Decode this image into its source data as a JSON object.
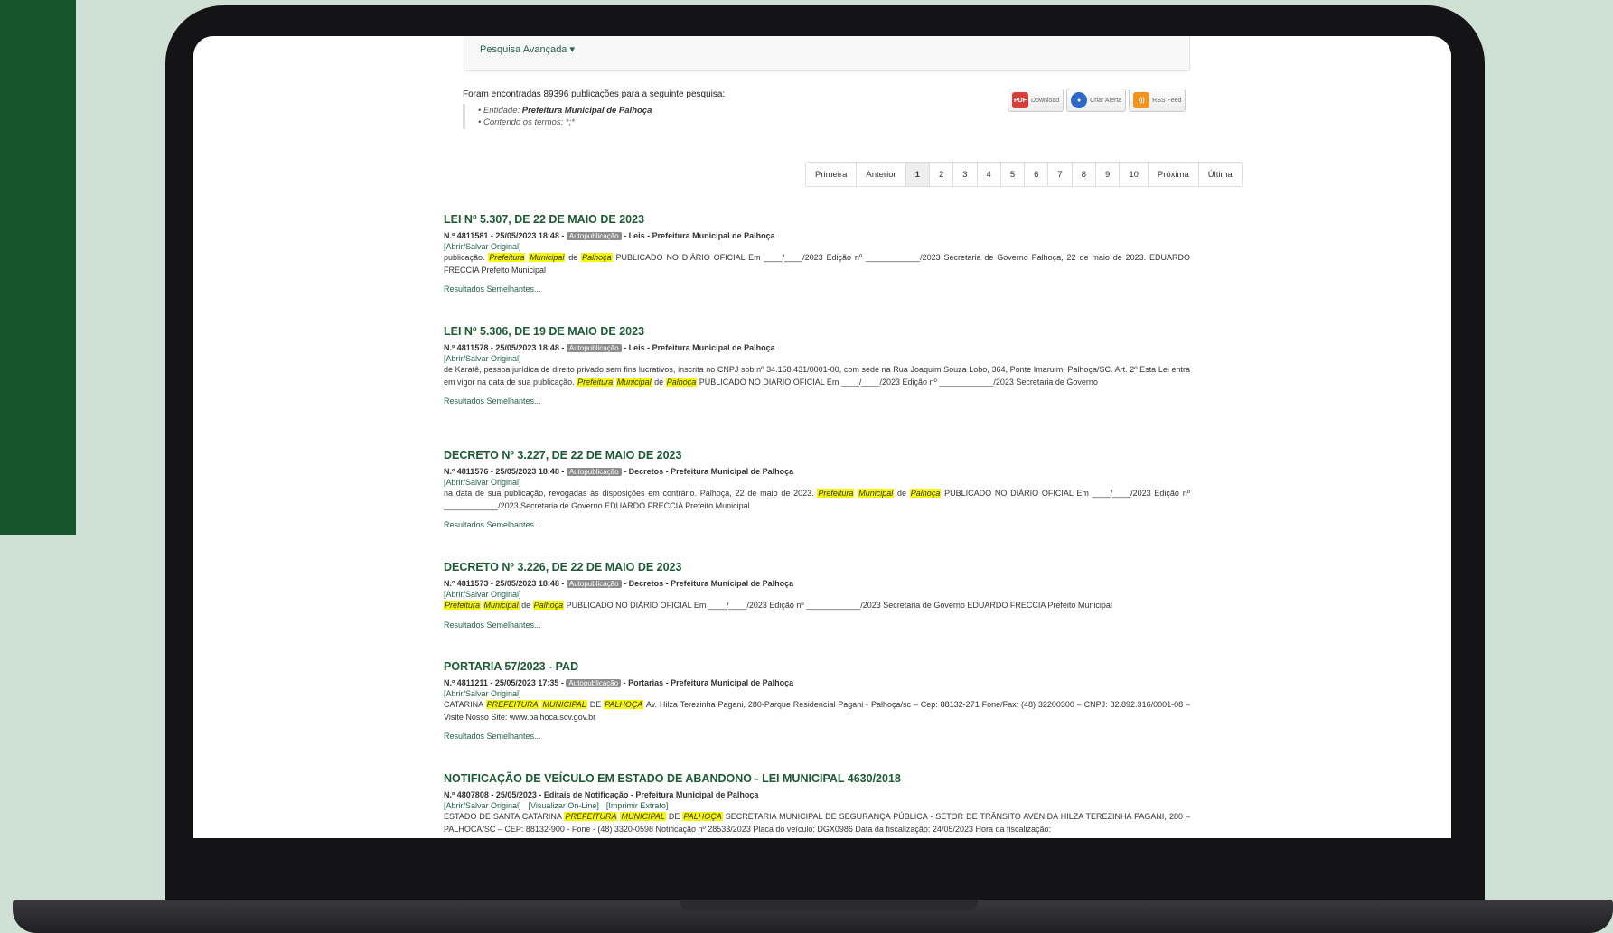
{
  "search": {
    "advanced_label": "Pesquisa Avançada ▾",
    "summary": "Foram encontradas 89396 publicações para a seguinte pesquisa:",
    "criteria": [
      {
        "label": "Entidade:",
        "value": "Prefeitura Municipal de Palhoça"
      },
      {
        "label": "Contendo os termos:",
        "value": "*;*"
      }
    ]
  },
  "actions": {
    "download": "Download",
    "alert": "Criar Alerta",
    "rss": "RSS Feed"
  },
  "pagination": [
    "Primeira",
    "Anterior",
    "1",
    "2",
    "3",
    "4",
    "5",
    "6",
    "7",
    "8",
    "9",
    "10",
    "Próxima",
    "Última"
  ],
  "pagination_active": "1",
  "results": [
    {
      "title": "LEI Nº 5.307, DE 22 DE MAIO DE 2023",
      "meta_prefix": "N.º 4811581 - 25/05/2023 18:48 -",
      "badge": "Autopublicação",
      "meta_suffix": "- Leis - Prefeitura Municipal de Palhoça",
      "links": [
        "[Abrir/Salvar Original]"
      ],
      "snippet_html": "publicação. <mark>Prefeitura</mark> <mark>Municipal</mark> de <mark>Palhoça</mark> PUBLICADO NO DIÁRIO OFICIAL Em ____/____/2023 Edição nº ____________/2023 Secretaria de Governo Palhoça, 22 de maio de 2023. EDUARDO FRECCIA Prefeito Municipal",
      "similar": "Resultados Semelhantes..."
    },
    {
      "title": "LEI Nº 5.306, DE 19 DE MAIO DE 2023",
      "meta_prefix": "N.º 4811578 - 25/05/2023 18:48 -",
      "badge": "Autopublicação",
      "meta_suffix": "- Leis - Prefeitura Municipal de Palhoça",
      "links": [
        "[Abrir/Salvar Original]"
      ],
      "snippet_html": "de Karatê, pessoa jurídica de direito privado sem fins lucrativos, inscrita no CNPJ sob nº 34.158.431/0001-00, com sede na Rua Joaquim Souza Lobo, 364, Ponte Imaruim, Palhoça/SC. Art. 2º Esta Lei entra em vigor na data de sua publicação. <mark>Prefeitura</mark> <mark>Municipal</mark> de <mark>Palhoça</mark> PUBLICADO NO DIÁRIO OFICIAL Em ____/____/2023 Edição nº ____________/2023 Secretaria de Governo",
      "similar": "Resultados Semelhantes..."
    },
    {
      "title": "DECRETO Nº 3.227, DE 22 DE MAIO DE 2023",
      "meta_prefix": "N.º 4811576 - 25/05/2023 18:48 -",
      "badge": "Autopublicação",
      "meta_suffix": "- Decretos - Prefeitura Municipal de Palhoça",
      "links": [
        "[Abrir/Salvar Original]"
      ],
      "snippet_html": "na data de sua publicação, revogadas às disposições em contrário. Palhoça, 22 de maio de 2023. <mark>Prefeitura</mark> <mark>Municipal</mark> de <mark>Palhoça</mark> PUBLICADO NO DIÁRIO OFICIAL Em ____/____/2023 Edição nº ____________/2023 Secretaria de Governo EDUARDO FRECCIA Prefeito Municipal",
      "similar": "Resultados Semelhantes..."
    },
    {
      "title": "DECRETO Nº 3.226, DE 22 DE MAIO DE 2023",
      "meta_prefix": "N.º 4811573 - 25/05/2023 18:48 -",
      "badge": "Autopublicação",
      "meta_suffix": "- Decretos - Prefeitura Municipal de Palhoça",
      "links": [
        "[Abrir/Salvar Original]"
      ],
      "snippet_html": "<mark>Prefeitura</mark> <mark>Municipal</mark> de <mark>Palhoça</mark> PUBLICADO NO DIÁRIO OFICIAL Em ____/____/2023 Edição nº ____________/2023 Secretaria de Governo EDUARDO FRECCIA Prefeito Municipal",
      "similar": "Resultados Semelhantes..."
    },
    {
      "title": "PORTARIA 57/2023 - PAD",
      "meta_prefix": "N.º 4811211 - 25/05/2023 17:35 -",
      "badge": "Autopublicação",
      "meta_suffix": "- Portarias - Prefeitura Municipal de Palhoça",
      "links": [
        "[Abrir/Salvar Original]"
      ],
      "snippet_html": "CATARINA <mark>PREFEITURA</mark> <mark>MUNICIPAL</mark> DE <mark>PALHOÇA</mark> Av. Hilza Terezinha Pagani, 280-Parque Residencial Pagani - Palhoça/sc – Cep: 88132-271 Fone/Fax: (48) 32200300 – CNPJ: 82.892.316/0001-08 – Visite Nosso Site: www.palhoca.scv.gov.br",
      "similar": "Resultados Semelhantes..."
    },
    {
      "title": "NOTIFICAÇÃO DE VEÍCULO EM ESTADO DE ABANDONO - LEI MUNICIPAL 4630/2018",
      "meta_prefix": "N.º 4807808 - 25/05/2023 - Editais de Notificação - Prefeitura Municipal de Palhoça",
      "badge": "",
      "meta_suffix": "",
      "links": [
        "[Abrir/Salvar Original]",
        "[Visualizar On-Line]",
        "[Imprimir Extrato]"
      ],
      "snippet_html": "ESTADO DE SANTA CATARINA <mark>PREFEITURA</mark> <mark>MUNICIPAL</mark> DE <mark>PALHOÇA</mark> SECRETARIA MUNICIPAL DE SEGURANÇA PÚBLICA - SETOR DE TRÂNSITO AVENIDA HILZA TEREZINHA PAGANI, 280 – PALHOCA/SC – CEP: 88132-900 - Fone - (48) 3320-0598 Notificação nº 28533/2023 Placa do veículo: DGX0986 Data da fiscalização: 24/05/2023 Hora da fiscalização:",
      "similar": ""
    }
  ]
}
